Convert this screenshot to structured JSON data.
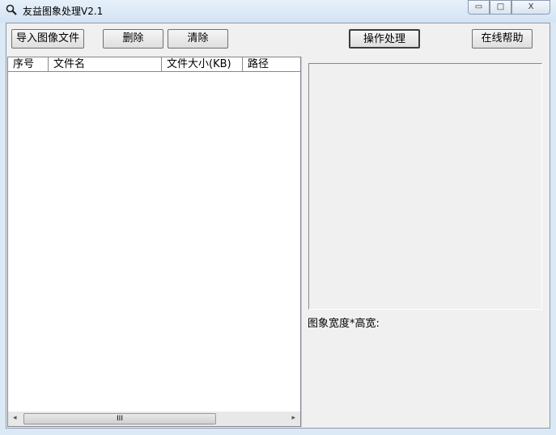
{
  "window": {
    "title": "友益图象处理V2.1",
    "minimize": "▭",
    "maximize": "□",
    "close": "X"
  },
  "toolbar": {
    "import": "导入图像文件",
    "delete": "删除",
    "clear": "清除",
    "process": "操作处理",
    "help": "在线帮助"
  },
  "list": {
    "columns": [
      "序号",
      "文件名",
      "文件大小(KB)",
      "路径"
    ],
    "rows": [],
    "scroll_left": "◂",
    "scroll_right": "▸",
    "scroll_grip": "III"
  },
  "preview": {
    "size_label": "图象宽度*高宽:"
  }
}
